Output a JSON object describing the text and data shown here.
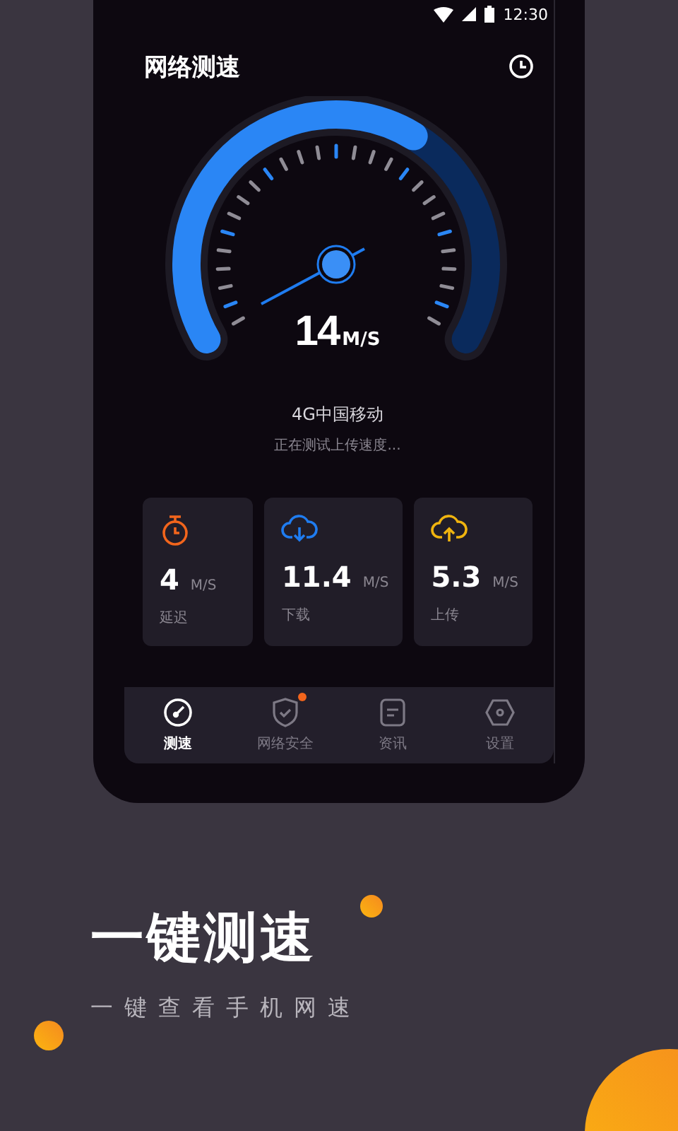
{
  "status_bar": {
    "time": "12:30"
  },
  "header": {
    "title": "网络测速"
  },
  "gauge": {
    "value": "14",
    "unit": "M/S"
  },
  "network": {
    "name": "4G中国移动",
    "status": "正在测试上传速度..."
  },
  "stats": [
    {
      "kind": "latency",
      "color": "#f2651c",
      "value": "4",
      "unit": "M/S",
      "label": "延迟"
    },
    {
      "kind": "download",
      "color": "#1f7cf0",
      "value": "11.4",
      "unit": "M/S",
      "label": "下载"
    },
    {
      "kind": "upload",
      "color": "#f0b40f",
      "value": "5.3",
      "unit": "M/S",
      "label": "上传"
    }
  ],
  "nav": [
    {
      "kind": "speed",
      "label": "测速",
      "selected": true,
      "badge": false
    },
    {
      "kind": "security",
      "label": "网络安全",
      "selected": false,
      "badge": true
    },
    {
      "kind": "news",
      "label": "资讯",
      "selected": false,
      "badge": false
    },
    {
      "kind": "settings",
      "label": "设置",
      "selected": false,
      "badge": false
    }
  ],
  "promo": {
    "title": "一键测速",
    "subtitle": "一键查看手机网速"
  }
}
